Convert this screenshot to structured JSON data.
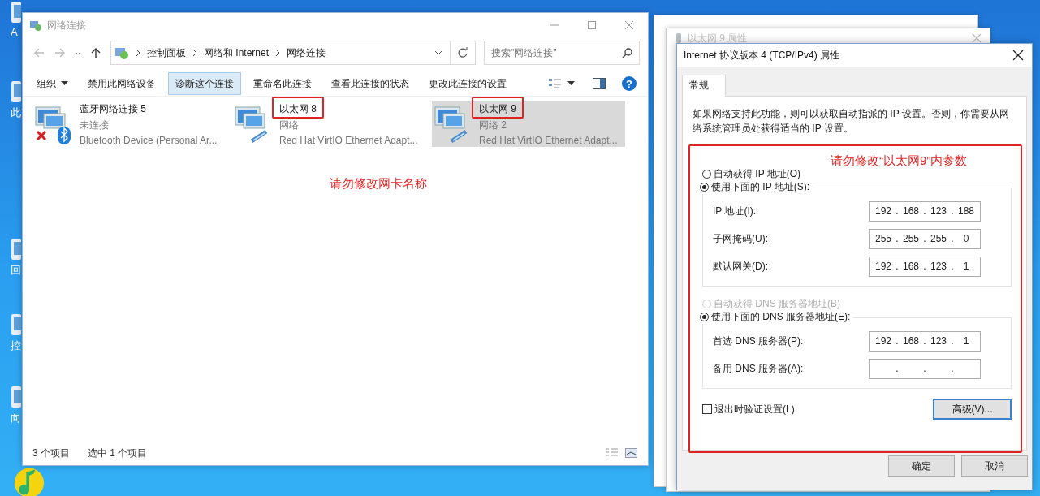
{
  "desktop_icons": [
    {
      "label": "A"
    },
    {
      "label": "此"
    },
    {
      "label": "回"
    },
    {
      "label": "控"
    },
    {
      "label": "向"
    }
  ],
  "explorer": {
    "title": "网络连接",
    "breadcrumb": [
      "控制面板",
      "网络和 Internet",
      "网络连接"
    ],
    "search": {
      "placeholder": "搜索\"网络连接\""
    },
    "toolbar": [
      {
        "label": "组织",
        "kind": "menu",
        "selected": false
      },
      {
        "label": "禁用此网络设备",
        "kind": "command",
        "selected": false
      },
      {
        "label": "诊断这个连接",
        "kind": "command",
        "selected": true
      },
      {
        "label": "重命名此连接",
        "kind": "command",
        "selected": false
      },
      {
        "label": "查看此连接的状态",
        "kind": "command",
        "selected": false
      },
      {
        "label": "更改此连接的设置",
        "kind": "command",
        "selected": false
      }
    ],
    "help_glyph": "?",
    "items": [
      {
        "name": "蓝牙网络连接 5",
        "status": "未连接",
        "device": "Bluetooth Device (Personal Ar...",
        "kind": "bluetooth",
        "selected": false,
        "marked": false
      },
      {
        "name": "以太网 8",
        "status": "网络",
        "device": "Red Hat VirtIO Ethernet Adapt...",
        "kind": "ethernet",
        "selected": false,
        "marked": true
      },
      {
        "name": "以太网 9",
        "status": "网络 2",
        "device": "Red Hat VirtIO Ethernet Adapt...",
        "kind": "ethernet",
        "selected": true,
        "marked": true
      }
    ],
    "note": "请勿修改网卡名称",
    "status_bar": [
      "3 个项目",
      "选中 1 个项目"
    ]
  },
  "properties_window": {
    "title": "以太网 9 属性"
  },
  "dialog": {
    "title": "Internet 协议版本 4 (TCP/IPv4) 属性",
    "tabs": [
      {
        "label": "常规",
        "selected": true
      }
    ],
    "description": "如果网络支持此功能，则可以获取自动指派的 IP 设置。否则，你需要从网络系统管理员处获得适当的 IP 设置。",
    "note": "请勿修改“以太网9”内参数",
    "ip_modes": [
      {
        "label": "自动获得 IP 地址(O)",
        "selected": false,
        "disabled": false
      },
      {
        "label": "使用下面的 IP 地址(S):",
        "selected": true,
        "disabled": false
      }
    ],
    "ip_fields": [
      {
        "label": "IP 地址(I):",
        "octets": [
          "192",
          "168",
          "123",
          "188"
        ],
        "dots": [
          ".",
          ".",
          "."
        ]
      },
      {
        "label": "子网掩码(U):",
        "octets": [
          "255",
          "255",
          "255",
          "0"
        ],
        "dots": [
          ".",
          ".",
          "."
        ]
      },
      {
        "label": "默认网关(D):",
        "octets": [
          "192",
          "168",
          "123",
          "1"
        ],
        "dots": [
          ".",
          ".",
          "."
        ]
      }
    ],
    "dns_modes": [
      {
        "label": "自动获得 DNS 服务器地址(B)",
        "selected": false,
        "disabled": true
      },
      {
        "label": "使用下面的 DNS 服务器地址(E):",
        "selected": true,
        "disabled": false
      }
    ],
    "dns_fields": [
      {
        "label": "首选 DNS 服务器(P):",
        "octets": [
          "192",
          "168",
          "123",
          "1"
        ],
        "dots": [
          ".",
          ".",
          "."
        ]
      },
      {
        "label": "备用 DNS 服务器(A):",
        "dots": [
          ".",
          ".",
          "."
        ]
      }
    ],
    "validate": {
      "label": "退出时验证设置(L)",
      "checked": false
    },
    "advanced_button": {
      "label": "高级(V)...",
      "focused": true
    },
    "buttons": [
      "确定",
      "取消"
    ]
  }
}
